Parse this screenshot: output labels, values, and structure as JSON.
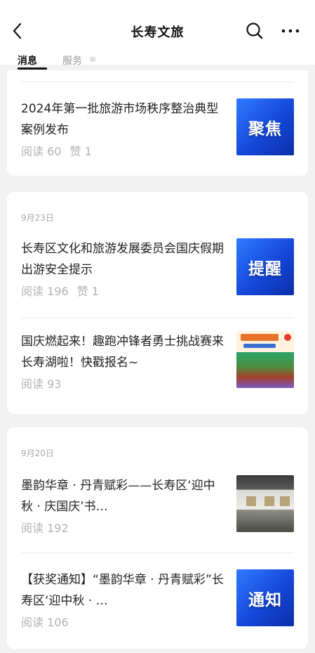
{
  "header": {
    "title": "长寿文旅",
    "tabs": [
      "消息",
      "服务"
    ]
  },
  "feed": {
    "group1": {
      "items": [
        {
          "title": "2024年第一批旅游市场秩序整治典型案例发布",
          "reads": "阅读 60",
          "likes": "赞 1",
          "thumb_text": "聚焦"
        }
      ]
    },
    "group2": {
      "date": "9月23日",
      "items": [
        {
          "title": "长寿区文化和旅游发展委员会国庆假期出游安全提示",
          "reads": "阅读 196",
          "likes": "赞 1",
          "thumb_text": "提醒"
        },
        {
          "title": "国庆燃起来！趣跑冲锋者勇士挑战赛来长寿湖啦！快戳报名~",
          "reads": "阅读 93"
        }
      ]
    },
    "group3": {
      "date": "9月20日",
      "items": [
        {
          "title": "墨韵华章 · 丹青赋彩——长寿区‘迎中秋 · 庆国庆’书…",
          "reads": "阅读 192"
        },
        {
          "title": "【获奖通知】“墨韵华章 · 丹青赋彩”长寿区‘迎中秋 · …",
          "reads": "阅读 106",
          "thumb_text": "通知"
        }
      ]
    }
  },
  "icons": {
    "back": "chevron-left-icon",
    "search": "search-icon",
    "more": "more-icon",
    "tab_menu": "menu-icon"
  },
  "colors": {
    "thumb_blue": "#1f5fe8",
    "meta_text": "#b3b3b3"
  }
}
